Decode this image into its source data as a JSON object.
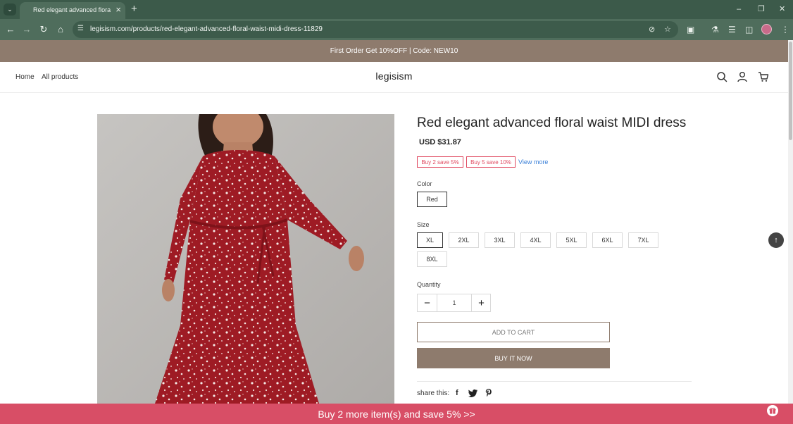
{
  "browser": {
    "tab_title": "Red elegant advanced floral wa",
    "url": "legisism.com/products/red-elegant-advanced-floral-waist-midi-dress-11829",
    "icons": [
      "tab-list-icon",
      "close-icon",
      "plus-icon",
      "minimize-icon",
      "restore-icon",
      "close-window-icon",
      "back-icon",
      "forward-icon",
      "reload-icon",
      "home-icon",
      "site-info-icon",
      "eye-off-icon",
      "star-icon",
      "extensions-icon",
      "labs-icon",
      "media-icon",
      "sidepanel-icon",
      "kebab-menu-icon"
    ]
  },
  "announcement": "First Order Get 10%OFF | Code:  NEW10",
  "header": {
    "nav": [
      "Home",
      "All products"
    ],
    "logo": "legisism"
  },
  "product": {
    "title": "Red elegant advanced floral waist MIDI dress",
    "price": "USD $31.87",
    "promos": [
      "Buy 2 save 5%",
      "Buy 5 save 10%"
    ],
    "view_more": "View more",
    "color_label": "Color",
    "colors": [
      "Red"
    ],
    "selected_color": "Red",
    "size_label": "Size",
    "sizes": [
      "XL",
      "2XL",
      "3XL",
      "4XL",
      "5XL",
      "6XL",
      "7XL",
      "8XL"
    ],
    "selected_size": "XL",
    "quantity_label": "Quantity",
    "quantity": "1",
    "add_to_cart": "ADD TO CART",
    "buy_now": "BUY IT NOW",
    "share_label": "share this:"
  },
  "bottom_bar": "Buy 2 more item(s) and save 5%  >>",
  "colors": {
    "chrome_dark": "#3c5a4a",
    "chrome": "#4f6d5c",
    "brand": "#8e7b6d",
    "promo": "#e0485f",
    "bottom_bar": "#d84e66",
    "dress_red": "#9e1b24"
  }
}
